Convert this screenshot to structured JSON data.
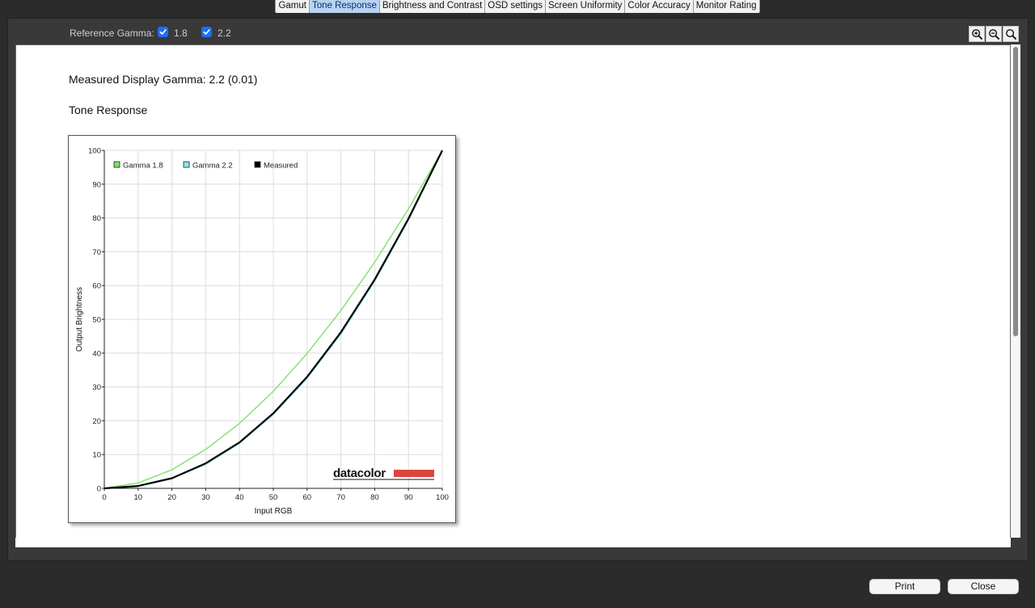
{
  "tabs": [
    {
      "label": "Gamut",
      "active": false
    },
    {
      "label": "Tone Response",
      "active": true
    },
    {
      "label": "Brightness and Contrast",
      "active": false
    },
    {
      "label": "OSD settings",
      "active": false
    },
    {
      "label": "Screen Uniformity",
      "active": false
    },
    {
      "label": "Color Accuracy",
      "active": false
    },
    {
      "label": "Monitor Rating",
      "active": false
    }
  ],
  "toolbar": {
    "reference_label": "Reference Gamma:",
    "options": [
      {
        "label": "1.8",
        "checked": true
      },
      {
        "label": "2.2",
        "checked": true
      }
    ],
    "zoom_buttons": [
      "zoom-in-icon",
      "zoom-out-icon",
      "zoom-fit-icon"
    ]
  },
  "content": {
    "measured_gamma": "Measured Display Gamma: 2.2 (0.01)",
    "section_title": "Tone Response"
  },
  "chart_data": {
    "type": "line",
    "xlabel": "Input RGB",
    "ylabel": "Output Brightness",
    "xlim": [
      0,
      100
    ],
    "ylim": [
      0,
      100
    ],
    "x_ticks": [
      "0",
      "10",
      "20",
      "30",
      "40",
      "50",
      "60",
      "70",
      "80",
      "90",
      "100"
    ],
    "y_ticks": [
      "0",
      "10",
      "20",
      "30",
      "40",
      "50",
      "60",
      "70",
      "80",
      "90",
      "100"
    ],
    "grid": true,
    "legend_position": "top-left",
    "watermark": "datacolor",
    "x": [
      0,
      10,
      20,
      30,
      40,
      50,
      60,
      70,
      80,
      90,
      100
    ],
    "series": [
      {
        "name": "Gamma 1.8",
        "color": "#7ee36a",
        "values": [
          0,
          1.6,
          5.5,
          11.5,
          19.2,
          28.7,
          39.9,
          52.6,
          66.9,
          82.7,
          100
        ]
      },
      {
        "name": "Gamma 2.2",
        "color": "#8fe3f2",
        "values": [
          0,
          0.6,
          2.9,
          7.1,
          13.3,
          21.8,
          32.5,
          45.6,
          61.2,
          79.3,
          100
        ]
      },
      {
        "name": "Measured",
        "color": "#000000",
        "values": [
          0,
          0.7,
          3.0,
          7.4,
          13.6,
          22.2,
          33.0,
          46.2,
          61.8,
          79.8,
          100
        ]
      }
    ]
  },
  "footer": {
    "print_label": "Print",
    "close_label": "Close"
  }
}
